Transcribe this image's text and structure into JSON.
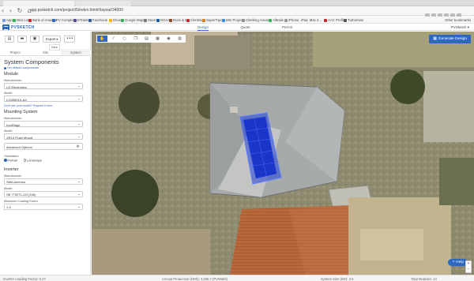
{
  "browser": {
    "url": "app.pvsketch.com/project/5/index.html#/layout/34000",
    "bookmarks": [
      "Apps",
      "Mint.com",
      "Bank of America",
      "PV Complete",
      "ETrade",
      "Facebook",
      "Drive",
      "Google Maps",
      "Store",
      "NOAA",
      "Rock & Ice",
      "Climbing",
      "SuperTopo",
      "Mtn Project",
      "Climbing Areas",
      "Alltrails",
      "iPhone, iPad, Mac Ir...",
      "AAC Profile",
      "Turbomine"
    ],
    "other_bookmarks": "Other bookmarks"
  },
  "app": {
    "logo": "PVSKETCH",
    "tabs": [
      "Design",
      "Quote",
      "Permit"
    ],
    "active_tab": "Design",
    "user_menu": "PVSketch ▾"
  },
  "toolbar": {
    "export_label": "Export ▾",
    "more_label": "•••",
    "tooltip": "Save"
  },
  "sidebar": {
    "tabs": [
      "Project",
      "Site",
      "System"
    ],
    "active_tab": "System",
    "title": "System Components",
    "default_link": "Set default components",
    "module": {
      "title": "Module",
      "manufacturer_label": "Manufacturer",
      "manufacturer": "LG Electronics",
      "model_label": "Model",
      "model": "LG285S1K-A3",
      "warn_link": "Don't see your model? Request it here."
    },
    "mounting": {
      "title": "Mounting System",
      "manufacturer_label": "Manufacturer",
      "manufacturer": "IronRidge",
      "model_label": "Model",
      "model": "XR10 Flush Mount",
      "advanced_label": "Advanced Options"
    },
    "orientation": {
      "label": "Orientation",
      "options": [
        "Portrait",
        "Landscape"
      ],
      "selected": "Portrait"
    },
    "inverter": {
      "title": "Inverter",
      "manufacturer_label": "Manufacturer",
      "manufacturer": "SMA America",
      "model_label": "Model",
      "model": "SB 7700TL-US (240)",
      "max_loading_label": "Maximum Loading Factor",
      "max_loading": "1.3"
    }
  },
  "map": {
    "generate_label": "Generate Design",
    "help_label": "Help"
  },
  "footer": {
    "loading_factor": "Inverter Loading Factor: 0.47",
    "annual_production": "Annual Production (kWh): 4,936.7 (PVWatts)",
    "system_size": "System Size (kW): 3.6",
    "total_modules": "Total Modules: 14"
  },
  "colors": {
    "accent": "#2c68c0",
    "panel_fill": "#1f3fd8",
    "roof": "#a7aaaa"
  }
}
